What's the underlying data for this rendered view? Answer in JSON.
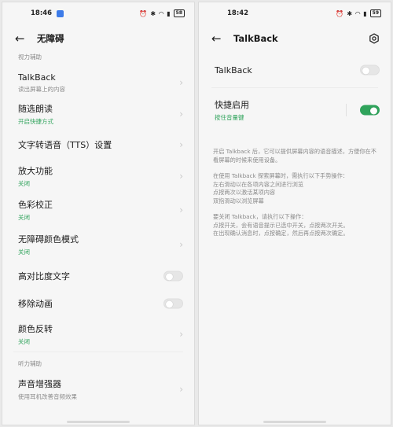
{
  "left": {
    "status": {
      "time": "18:46",
      "battery": "58"
    },
    "header": {
      "title": "无障碍"
    },
    "section_vision": "视力辅助",
    "items": [
      {
        "title": "TalkBack",
        "subtitle": "读出屏幕上的内容"
      },
      {
        "title": "随选朗读",
        "subtitle": "开启快捷方式"
      },
      {
        "title": "文字转语音（TTS）设置",
        "subtitle": ""
      },
      {
        "title": "放大功能",
        "subtitle": "关闭"
      },
      {
        "title": "色彩校正",
        "subtitle": "关闭"
      },
      {
        "title": "无障碍颜色模式",
        "subtitle": "关闭"
      },
      {
        "title": "高对比度文字",
        "subtitle": ""
      },
      {
        "title": "移除动画",
        "subtitle": ""
      },
      {
        "title": "颜色反转",
        "subtitle": "关闭"
      }
    ],
    "toggles": {
      "high_contrast": false,
      "remove_animation": false
    },
    "section_hearing": "听力辅助",
    "hearing_item": {
      "title": "声音增强器",
      "subtitle": "使用耳机改善音频效果"
    }
  },
  "right": {
    "status": {
      "time": "18:42",
      "battery": "59"
    },
    "header": {
      "title": "TalkBack"
    },
    "talkback_row": {
      "title": "TalkBack",
      "on": false
    },
    "shortcut_row": {
      "title": "快捷启用",
      "subtitle": "按住音量键",
      "on": true
    },
    "desc": {
      "p1": "开启 Talkback 后，它可以提供屏幕内容的语音描述，方便你在不看屏幕的时候来使用设备。",
      "p2_l1": "在使用 Talkback 探索屏幕时，需执行以下手势操作：",
      "p2_l2": "左右滑动以在各项内容之间进行浏览",
      "p2_l3": "点按两次以激活某项内容",
      "p2_l4": "双指滑动以浏览屏幕",
      "p3_l1": "要关闭 Talkback，请执行以下操作：",
      "p3_l2": "点按开关，会有语音提示已选中开关，点按两次开关。",
      "p3_l3": "在出现确认消息时，点按确定，然后再点按两次确定。"
    }
  }
}
